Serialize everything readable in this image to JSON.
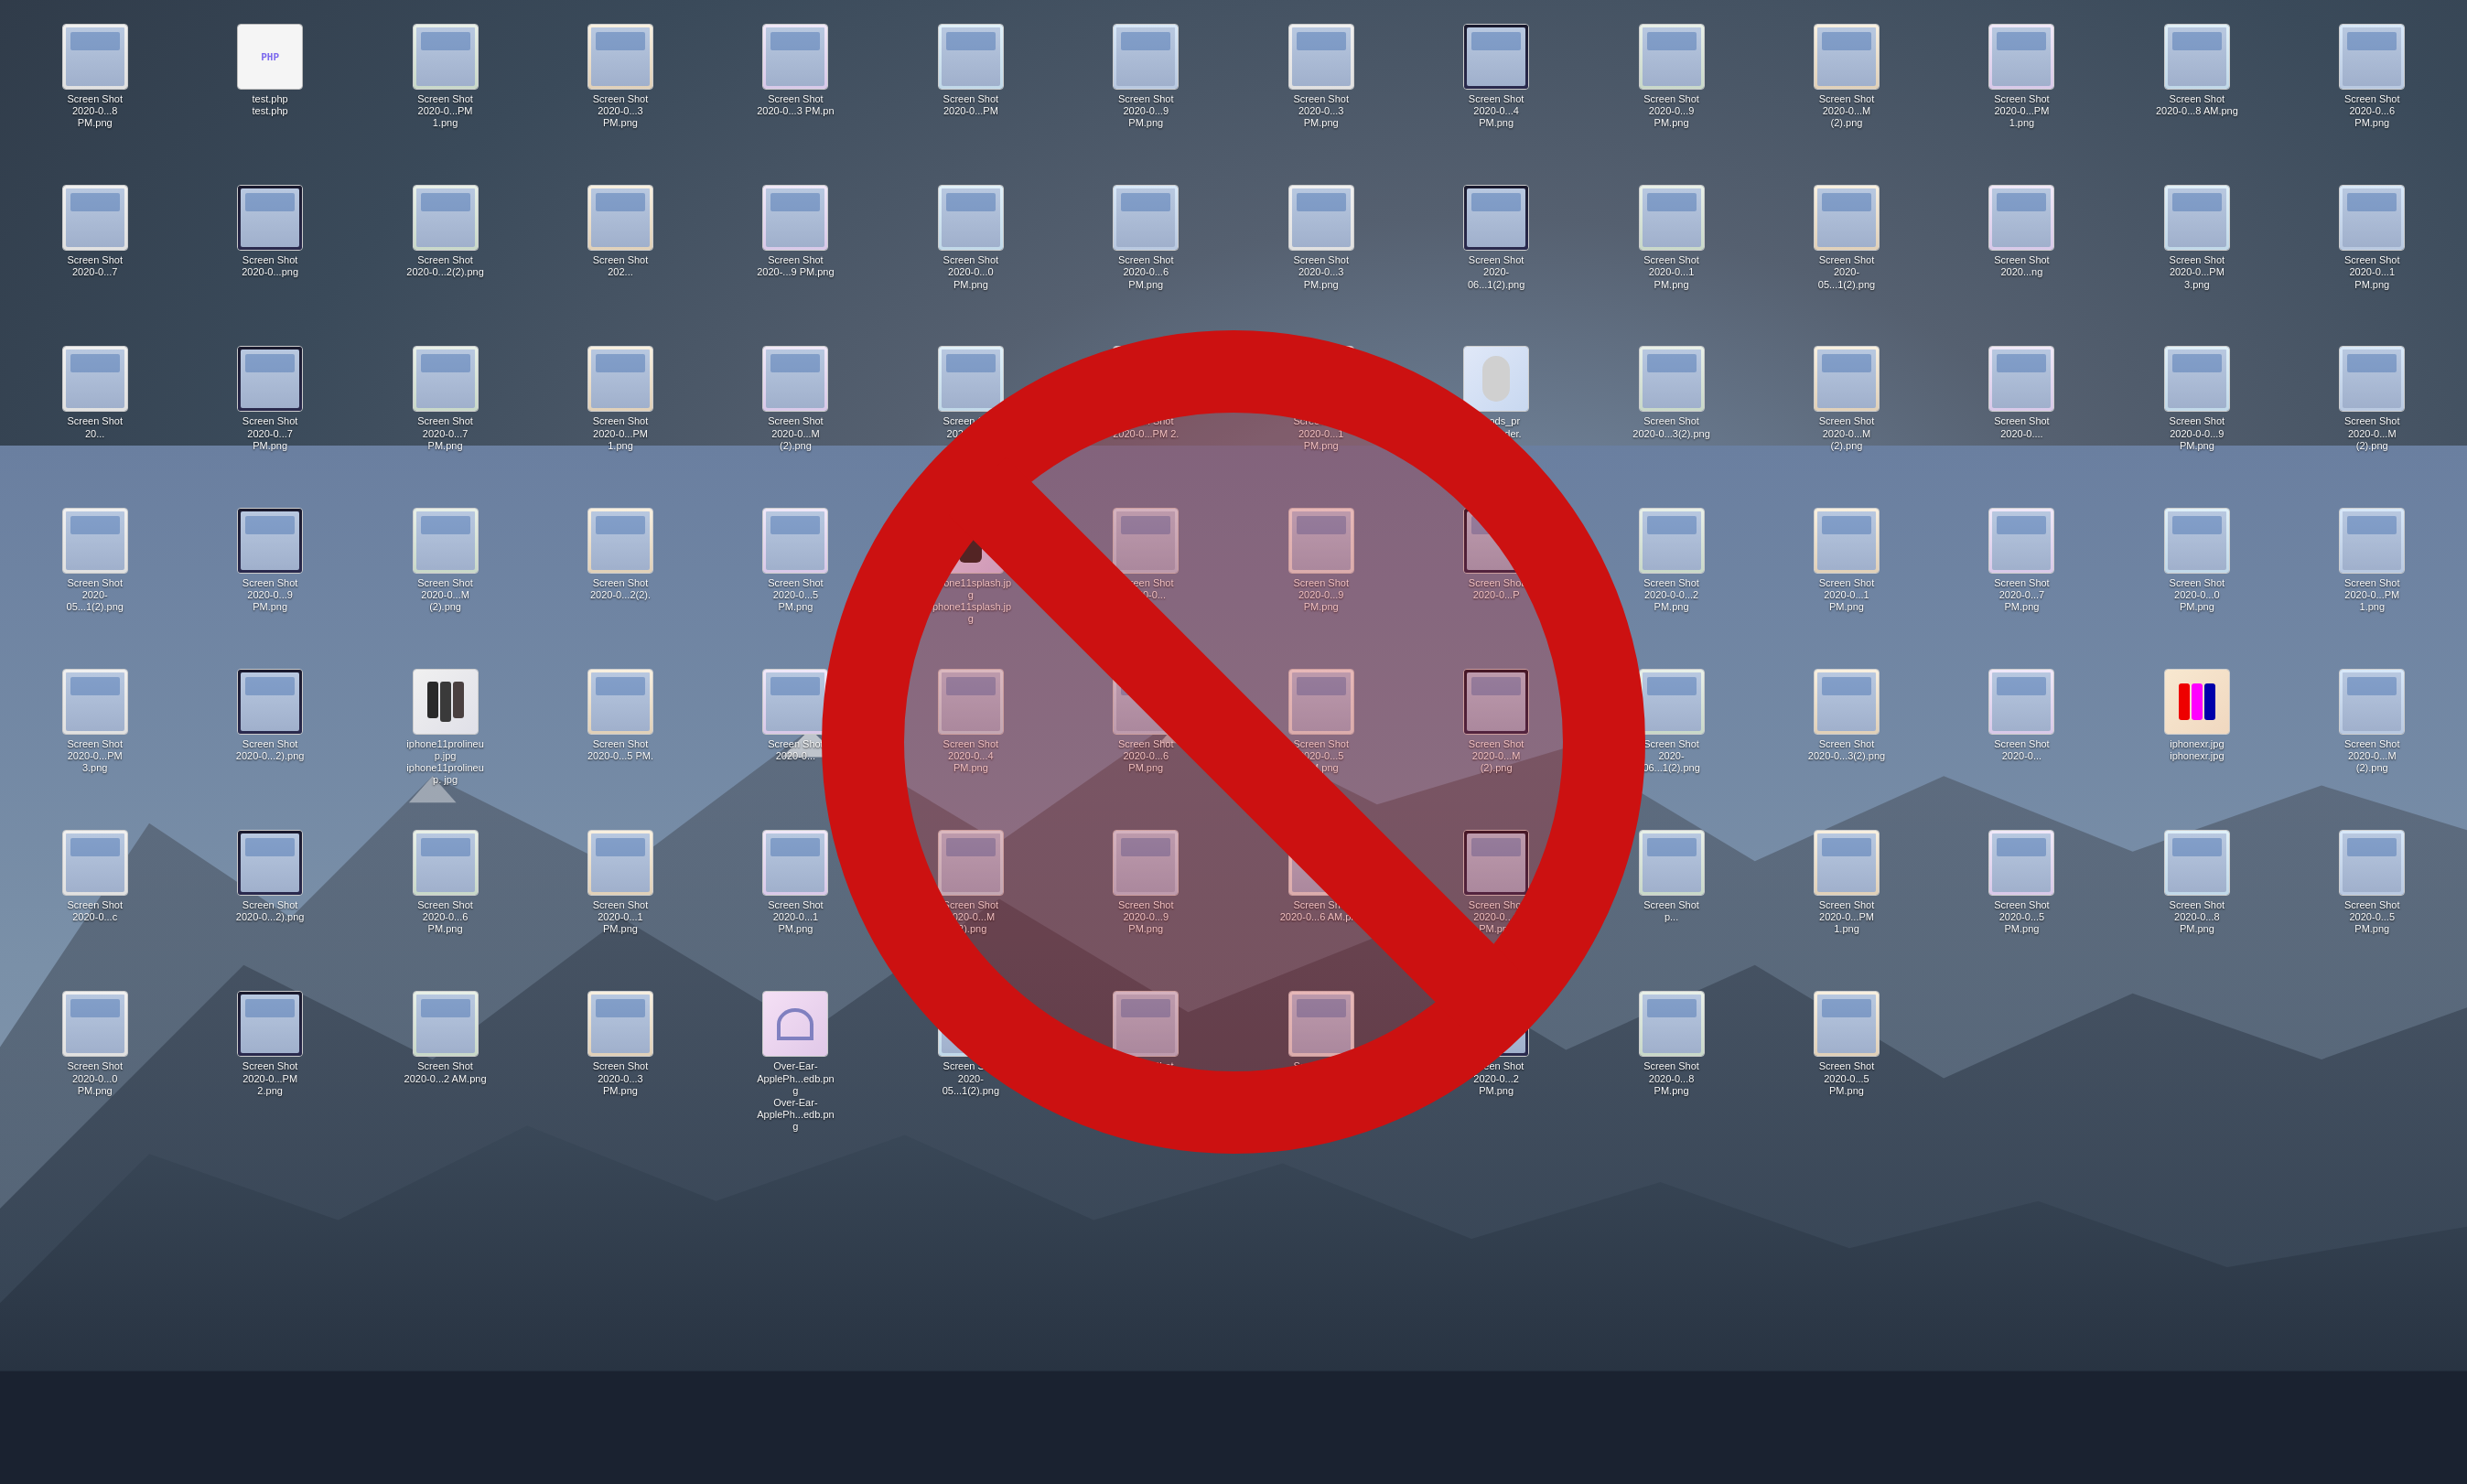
{
  "wallpaper": {
    "description": "macOS Catalina mountain wallpaper"
  },
  "desktop": {
    "files": [
      {
        "id": 1,
        "name": "Screen Shot",
        "label": "2020-0...8 PM.png",
        "type": "screenshot"
      },
      {
        "id": 2,
        "name": "test.php",
        "label": "test.php",
        "type": "php"
      },
      {
        "id": 3,
        "name": "Screen Shot",
        "label": "2020-0...PM 1.png",
        "type": "screenshot"
      },
      {
        "id": 4,
        "name": "Screen Shot",
        "label": "2020-0...3 PM.png",
        "type": "screenshot"
      },
      {
        "id": 5,
        "name": "Screen Shot",
        "label": "2020-0...3 PM.pn",
        "type": "screenshot"
      },
      {
        "id": 6,
        "name": "Screen Shot",
        "label": "2020-0...PM",
        "type": "screenshot"
      },
      {
        "id": 7,
        "name": "Screen Shot",
        "label": "2020-0...9 PM.png",
        "type": "screenshot"
      },
      {
        "id": 8,
        "name": "Screen Shot",
        "label": "2020-0...3 PM.png",
        "type": "screenshot"
      },
      {
        "id": 9,
        "name": "Screen Shot",
        "label": "2020-0...4 PM.png",
        "type": "screenshot"
      },
      {
        "id": 10,
        "name": "Screen Shot",
        "label": "2020-0...9 PM.png",
        "type": "screenshot"
      },
      {
        "id": 11,
        "name": "Screen Shot",
        "label": "2020-0...M (2).png",
        "type": "screenshot"
      },
      {
        "id": 12,
        "name": "Screen Shot",
        "label": "2020-0...PM 1.png",
        "type": "screenshot"
      },
      {
        "id": 13,
        "name": "Screen Shot",
        "label": "2020-0...8 AM.png",
        "type": "screenshot"
      },
      {
        "id": 14,
        "name": "Screen Shot",
        "label": "2020-0...6 PM.png",
        "type": "screenshot"
      },
      {
        "id": 15,
        "name": "Screen Shot",
        "label": "2020-0...7",
        "type": "screenshot"
      },
      {
        "id": 16,
        "name": "Screen Shot",
        "label": "2020-0...png",
        "type": "screenshot"
      },
      {
        "id": 17,
        "name": "Screen Shot",
        "label": "2020-0...2(2).png",
        "type": "screenshot"
      },
      {
        "id": 18,
        "name": "Screen Shot",
        "label": "202...",
        "type": "screenshot"
      },
      {
        "id": 19,
        "name": "Screen Shot",
        "label": "2020-...9 PM.png",
        "type": "screenshot"
      },
      {
        "id": 20,
        "name": "Screen Shot",
        "label": "2020-0...0 PM.png",
        "type": "screenshot"
      },
      {
        "id": 21,
        "name": "Screen Shot",
        "label": "2020-0...6 PM.png",
        "type": "screenshot"
      },
      {
        "id": 22,
        "name": "Screen Shot",
        "label": "2020-0...3 PM.png",
        "type": "screenshot"
      },
      {
        "id": 23,
        "name": "Screen Shot",
        "label": "2020-06...1(2).png",
        "type": "screenshot"
      },
      {
        "id": 24,
        "name": "Screen Shot",
        "label": "2020-0...1 PM.png",
        "type": "screenshot"
      },
      {
        "id": 25,
        "name": "Screen Shot",
        "label": "2020-05...1(2).png",
        "type": "screenshot"
      },
      {
        "id": 26,
        "name": "Screen Shot",
        "label": "2020...ng",
        "type": "screenshot"
      },
      {
        "id": 27,
        "name": "Screen Shot",
        "label": "2020-0...PM 3.png",
        "type": "screenshot"
      },
      {
        "id": 28,
        "name": "Screen Shot",
        "label": "2020-0...1 PM.png",
        "type": "screenshot"
      },
      {
        "id": 29,
        "name": "Screen Shot",
        "label": "20...",
        "type": "screenshot"
      },
      {
        "id": 30,
        "name": "Screen Shot",
        "label": "2020-0...7 PM.png",
        "type": "screenshot"
      },
      {
        "id": 31,
        "name": "Screen Shot",
        "label": "2020-0...7 PM.png",
        "type": "screenshot"
      },
      {
        "id": 32,
        "name": "Screen Shot",
        "label": "2020-0...PM 1.png",
        "type": "screenshot"
      },
      {
        "id": 33,
        "name": "Screen Shot",
        "label": "2020-0...M (2).png",
        "type": "screenshot"
      },
      {
        "id": 34,
        "name": "Screen Shot",
        "label": "2020-0...M (2).png",
        "type": "screenshot"
      },
      {
        "id": 35,
        "name": "Screen Shot",
        "label": "2020-0...PM 2.",
        "type": "screenshot"
      },
      {
        "id": 36,
        "name": "Screen Shot",
        "label": "2020-0...1 PM.png",
        "type": "screenshot"
      },
      {
        "id": 37,
        "name": "airpods_pr",
        "label": "up_header.",
        "type": "jpg"
      },
      {
        "id": 38,
        "name": "Screen Shot",
        "label": "2020-0...3(2).png",
        "type": "screenshot"
      },
      {
        "id": 39,
        "name": "Screen Shot",
        "label": "2020-0...M (2).png",
        "type": "screenshot"
      },
      {
        "id": 40,
        "name": "Screen Shot",
        "label": "2020-0....",
        "type": "screenshot"
      },
      {
        "id": 41,
        "name": "Screen Shot",
        "label": "2020-0-0...9 PM.png",
        "type": "screenshot"
      },
      {
        "id": 42,
        "name": "Screen Shot",
        "label": "2020-0...M (2).png",
        "type": "screenshot"
      },
      {
        "id": 43,
        "name": "Screen Shot",
        "label": "2020-05...1(2).png",
        "type": "screenshot"
      },
      {
        "id": 44,
        "name": "Screen Shot",
        "label": "2020-0...9 PM.png",
        "type": "screenshot"
      },
      {
        "id": 45,
        "name": "Screen Shot",
        "label": "2020-0...M (2).png",
        "type": "screenshot"
      },
      {
        "id": 46,
        "name": "Screen Shot",
        "label": "2020-0...2(2).",
        "type": "screenshot"
      },
      {
        "id": 47,
        "name": "Screen Shot",
        "label": "2020-0...5 PM.png",
        "type": "screenshot"
      },
      {
        "id": 48,
        "name": "iphone11splash.jpg",
        "label": "iphone11splash.jp g",
        "type": "jpg"
      },
      {
        "id": 49,
        "name": "Screen Shot",
        "label": "2020-0...",
        "type": "screenshot"
      },
      {
        "id": 50,
        "name": "Screen Shot",
        "label": "2020-0...9 PM.png",
        "type": "screenshot"
      },
      {
        "id": 51,
        "name": "Screen Shot",
        "label": "2020-0...P",
        "type": "screenshot"
      },
      {
        "id": 52,
        "name": "Screen Shot",
        "label": "2020-0-0...2 PM.png",
        "type": "screenshot"
      },
      {
        "id": 53,
        "name": "Screen Shot",
        "label": "2020-0...1 PM.png",
        "type": "screenshot"
      },
      {
        "id": 54,
        "name": "Screen Shot",
        "label": "2020-0...7 PM.png",
        "type": "screenshot"
      },
      {
        "id": 55,
        "name": "Screen Shot",
        "label": "2020-0...0 PM.png",
        "type": "screenshot"
      },
      {
        "id": 56,
        "name": "Screen Shot",
        "label": "2020-0...PM 1.png",
        "type": "screenshot"
      },
      {
        "id": 57,
        "name": "Screen Shot",
        "label": "2020-0...PM 3.png",
        "type": "screenshot"
      },
      {
        "id": 58,
        "name": "Screen Shot",
        "label": "2020-0...2).png",
        "type": "screenshot"
      },
      {
        "id": 59,
        "name": "iphone11prolineup.jpg",
        "label": "iphone11prolineup. jpg",
        "type": "jpg"
      },
      {
        "id": 60,
        "name": "Screen Shot",
        "label": "2020-0...5 PM.",
        "type": "screenshot"
      },
      {
        "id": 61,
        "name": "Screen Shot",
        "label": "2020-0...",
        "type": "screenshot"
      },
      {
        "id": 62,
        "name": "Screen Shot",
        "label": "2020-0...4 PM.png",
        "type": "screenshot"
      },
      {
        "id": 63,
        "name": "Screen Shot",
        "label": "2020-0...6 PM.png",
        "type": "screenshot"
      },
      {
        "id": 64,
        "name": "Screen Shot",
        "label": "2020-0...5 PM.png",
        "type": "screenshot"
      },
      {
        "id": 65,
        "name": "Screen Shot",
        "label": "2020-0...M (2).png",
        "type": "screenshot"
      },
      {
        "id": 66,
        "name": "Screen Shot",
        "label": "2020-06...1(2).png",
        "type": "screenshot"
      },
      {
        "id": 67,
        "name": "Screen Shot",
        "label": "2020-0...3(2).png",
        "type": "screenshot"
      },
      {
        "id": 68,
        "name": "Screen Shot",
        "label": "2020-0...",
        "type": "screenshot"
      },
      {
        "id": 69,
        "name": "iphonexr.jpg",
        "label": "iphonexr.jpg",
        "type": "jpg"
      },
      {
        "id": 70,
        "name": "Screen Shot",
        "label": "2020-0...M (2).png",
        "type": "screenshot"
      },
      {
        "id": 71,
        "name": "Screen Shot",
        "label": "2020-0...c",
        "type": "screenshot"
      },
      {
        "id": 72,
        "name": "Screen Shot",
        "label": "2020-0...2).png",
        "type": "screenshot"
      },
      {
        "id": 73,
        "name": "Screen Shot",
        "label": "2020-0...6 PM.png",
        "type": "screenshot"
      },
      {
        "id": 74,
        "name": "Screen Shot",
        "label": "2020-0...1 PM.png",
        "type": "screenshot"
      },
      {
        "id": 75,
        "name": "Screen Shot",
        "label": "2020-0...1 PM.png",
        "type": "screenshot"
      },
      {
        "id": 76,
        "name": "Screen Shot",
        "label": "2020-0...M (2).png",
        "type": "screenshot"
      },
      {
        "id": 77,
        "name": "Screen Shot",
        "label": "2020-0...9 PM.png",
        "type": "screenshot"
      },
      {
        "id": 78,
        "name": "Screen Shot",
        "label": "2020-0...6 AM.png",
        "type": "screenshot"
      },
      {
        "id": 79,
        "name": "Screen Shot",
        "label": "2020-0...1 PM.png",
        "type": "screenshot"
      },
      {
        "id": 80,
        "name": "Screen Shot",
        "label": "p...",
        "type": "screenshot"
      },
      {
        "id": 81,
        "name": "Screen Shot",
        "label": "2020-0...PM 1.png",
        "type": "screenshot"
      },
      {
        "id": 82,
        "name": "Screen Shot",
        "label": "2020-0...5 PM.png",
        "type": "screenshot"
      },
      {
        "id": 83,
        "name": "Screen Shot",
        "label": "2020-0...8 PM.png",
        "type": "screenshot"
      },
      {
        "id": 84,
        "name": "Screen Shot",
        "label": "2020-0...5 PM.png",
        "type": "screenshot"
      },
      {
        "id": 85,
        "name": "Screen Shot",
        "label": "2020-0...0 PM.png",
        "type": "screenshot"
      },
      {
        "id": 86,
        "name": "Screen Shot",
        "label": "2020-0...PM 2.png",
        "type": "screenshot"
      },
      {
        "id": 87,
        "name": "Screen Shot",
        "label": "2020-0...2 AM.png",
        "type": "screenshot"
      },
      {
        "id": 88,
        "name": "Screen Shot",
        "label": "2020-0...3 PM.png",
        "type": "screenshot"
      },
      {
        "id": 89,
        "name": "Over-Ear-ApplePh...edb.png",
        "label": "Over-Ear- ApplePh...edb.png",
        "type": "jpg"
      },
      {
        "id": 90,
        "name": "Screen Shot",
        "label": "2020-05...1(2).png",
        "type": "screenshot"
      },
      {
        "id": 91,
        "name": "Screen Shot",
        "label": "2020-05...1(2).png",
        "type": "screenshot"
      },
      {
        "id": 92,
        "name": "Screen Shot",
        "label": "2020-05...1(2).png",
        "type": "screenshot"
      },
      {
        "id": 93,
        "name": "Screen Shot",
        "label": "2020-0...2 PM.png",
        "type": "screenshot"
      },
      {
        "id": 94,
        "name": "Screen Shot",
        "label": "2020-0...8 PM.png",
        "type": "screenshot"
      },
      {
        "id": 95,
        "name": "Screen Shot",
        "label": "2020-0...5 PM.png",
        "type": "screenshot"
      }
    ]
  },
  "no_symbol": {
    "description": "Large red prohibition/no symbol overlaid on desktop"
  }
}
